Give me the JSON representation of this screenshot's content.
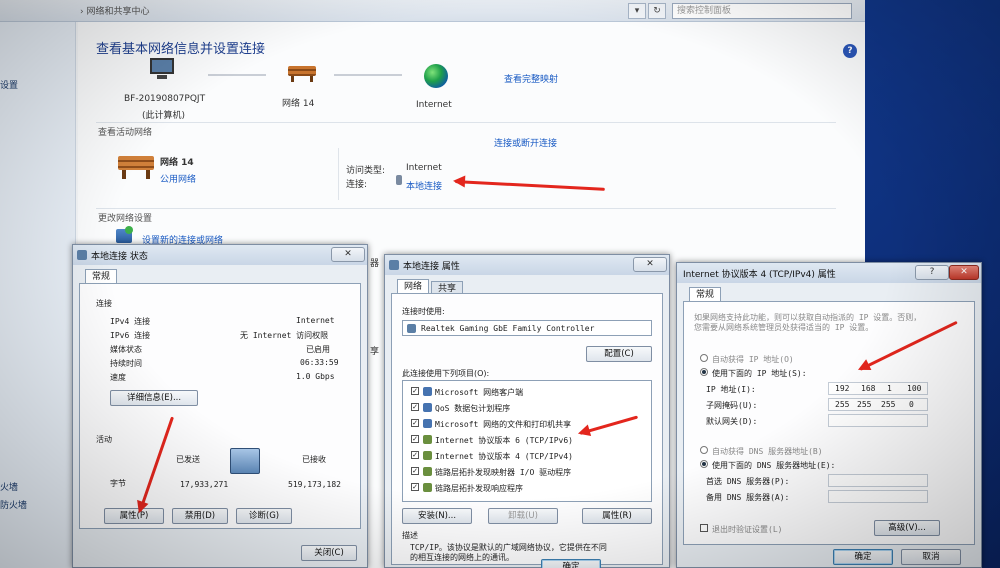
{
  "nsc": {
    "breadcrumb": "› 网络和共享中心",
    "search_placeholder": "搜索控制面板",
    "left_items": [
      "设置",
      "火墙",
      "防火墙"
    ],
    "title": "查看基本网络信息并设置连接",
    "view_full_map": "查看完整映射",
    "computer_name": "BF-20190807PQJT",
    "computer_sub": "(此计算机)",
    "network_name": "网络 14",
    "internet": "Internet",
    "active_networks": "查看活动网络",
    "connect_disconnect": "连接或断开连接",
    "net_name_big": "网络  14",
    "net_type": "公用网络",
    "access_type_label": "访问类型:",
    "access_type_value": "Internet",
    "connection_label": "连接:",
    "connection_value": "本地连接",
    "change_settings": "更改网络设置",
    "setup_new": "设置新的连接或网络",
    "partial_1": "器",
    "partial_2": "享"
  },
  "status_dialog": {
    "title": "本地连接 状态",
    "tab": "常规",
    "section_connection": "连接",
    "rows": [
      {
        "label": "IPv4 连接",
        "value": "Internet"
      },
      {
        "label": "IPv6 连接",
        "value": "无 Internet 访问权限"
      },
      {
        "label": "媒体状态",
        "value": "已启用"
      },
      {
        "label": "持续时间",
        "value": "06:33:59"
      },
      {
        "label": "速度",
        "value": "1.0 Gbps"
      }
    ],
    "details_btn": "详细信息(E)...",
    "section_activity": "活动",
    "sent_label": "已发送",
    "recv_label": "已接收",
    "bytes_label": "字节",
    "bytes_sent": "17,933,271",
    "bytes_recv": "519,173,182",
    "properties_btn": "属性(P)",
    "disable_btn": "禁用(D)",
    "diagnose_btn": "诊断(G)",
    "close_btn": "关闭(C)"
  },
  "props_dialog": {
    "title": "本地连接 属性",
    "tab_network": "网络",
    "tab_sharing": "共享",
    "connect_using": "连接时使用:",
    "adapter": "Realtek Gaming GbE Family Controller",
    "configure_btn": "配置(C)",
    "items_label": "此连接使用下列项目(O):",
    "items": [
      "Microsoft 网络客户端",
      "QoS 数据包计划程序",
      "Microsoft 网络的文件和打印机共享",
      "Internet 协议版本 6 (TCP/IPv6)",
      "Internet 协议版本 4 (TCP/IPv4)",
      "链路层拓扑发现映射器 I/O 驱动程序",
      "链路层拓扑发现响应程序"
    ],
    "install_btn": "安装(N)...",
    "uninstall_btn": "卸载(U)",
    "properties_btn": "属性(R)",
    "desc_label": "描述",
    "desc_text_1": "TCP/IP。该协议是默认的广域网络协议，它提供在不同",
    "desc_text_2": "的相互连接的网络上的通讯。",
    "ok_btn": "确定"
  },
  "ipv4_dialog": {
    "title": "Internet 协议版本 4 (TCP/IPv4) 属性",
    "tab": "常规",
    "intro_1": "如果网络支持此功能，则可以获取自动指派的 IP 设置。否则，",
    "intro_2": "您需要从网络系统管理员处获得适当的 IP 设置。",
    "auto_ip": "自动获得 IP 地址(O)",
    "manual_ip": "使用下面的 IP 地址(S):",
    "ip_label": "IP 地址(I):",
    "ip_parts": [
      "192",
      "168",
      "1",
      "100"
    ],
    "mask_label": "子网掩码(U):",
    "mask_parts": [
      "255",
      "255",
      "255",
      "0"
    ],
    "gateway_label": "默认网关(D):",
    "auto_dns": "自动获得 DNS 服务器地址(B)",
    "manual_dns": "使用下面的 DNS 服务器地址(E):",
    "dns1_label": "首选 DNS 服务器(P):",
    "dns2_label": "备用 DNS 服务器(A):",
    "validate_label": "退出时验证设置(L)",
    "advanced_btn": "高级(V)...",
    "ok_btn": "确定",
    "cancel_btn": "取消"
  },
  "colors": {
    "arrow": "#e3261d",
    "link": "#1a5bc4",
    "title": "#1e3f8f"
  }
}
